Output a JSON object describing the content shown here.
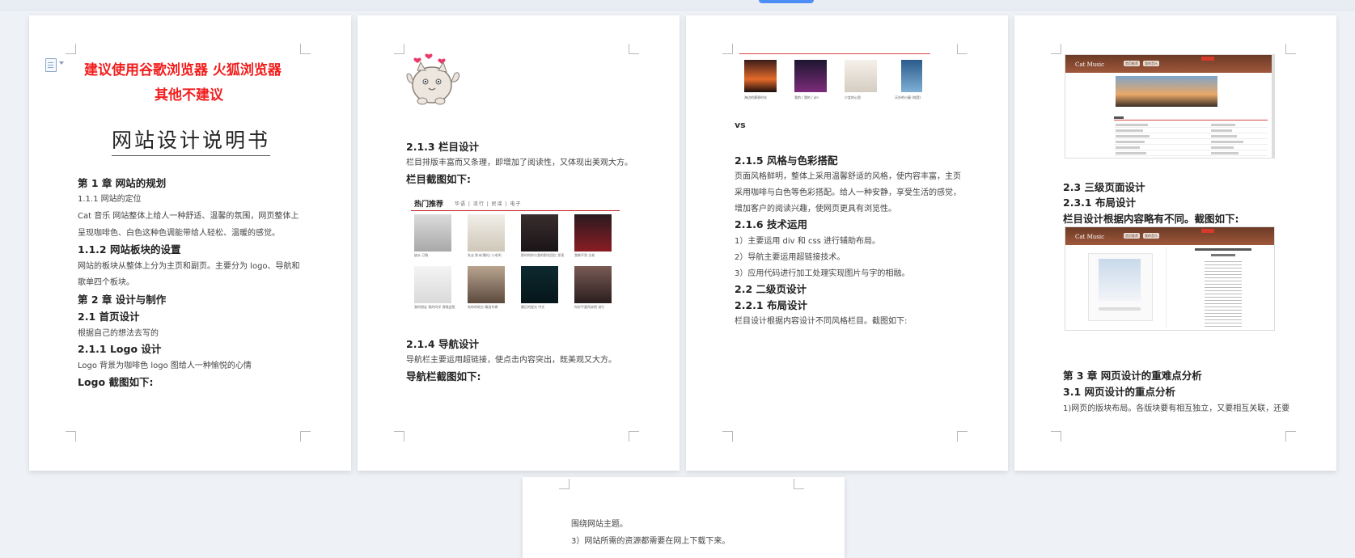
{
  "document_title": "网站设计说明书",
  "pages": {
    "p1": {
      "notice_line1": "建议使用谷歌浏览器   火狐浏览器",
      "notice_line2": "其他不建议",
      "title": "网站设计说明书",
      "ch1": "第 1 章  网站的规划",
      "s111": "1.1.1  网站的定位",
      "p111a": "Cat 音乐  网站整体上给人一种舒适、温馨的氛围，网页整体上",
      "p111b": "呈现咖啡色、白色这种色调能带给人轻松、温暖的感觉。",
      "s112": "1.1.2  网站板块的设置",
      "p112a": "网站的板块从整体上分为主页和副页。主要分为 logo、导航和",
      "p112b": "歌单四个板块。",
      "ch2": "第 2 章  设计与制作",
      "s21": "2.1  首页设计",
      "p21": "根据自己的想法去写的",
      "s211": "2.1.1 Logo 设计",
      "p211": "Logo 背景为咖啡色 logo 图给人一种愉悦的心情",
      "logo_caption": "Logo 截图如下:"
    },
    "p2": {
      "s213": "2.1.3  栏目设计",
      "p213": "栏目排版丰富而又条理，即增加了阅读性，又体现出美观大方。",
      "col_caption": "栏目截图如下:",
      "hot_title": "热门推荐",
      "hot_tabs": "华语 | 流行 | 民谣 | 电子",
      "thumb_captions": [
        "缺水\n已购",
        "失去\n陈未(赠礼) 小毛叫",
        "那时的你与我的那些回忆\n发现",
        "我做不到\n古老",
        "我的朋友 我的同学\n演唱会版",
        "有你的地方\n精选专辑",
        "最后的星光\n中文",
        "你好不要再说吧\n流行"
      ],
      "s214": "2.1.4  导航设计",
      "p214": "导航栏主要运用超链接，使点击内容突出，既美观又大方。",
      "nav_caption": "导航栏截图如下:"
    },
    "p3": {
      "strip_captions": [
        "海边的黄昏时光",
        "我的 / 我的 / jon",
        "少女的心思",
        "天外的小屋 (纯音)"
      ],
      "vs": "vs",
      "s215": "2.1.5  风格与色彩搭配",
      "p215a": "页面风格鲜明，整体上采用温馨舒适的风格，使内容丰富，主页",
      "p215b": "采用咖啡与白色等色彩搭配。给人一种安静，享受生活的感觉，",
      "p215c": "增加客户的阅读兴趣，使网页更具有浏览性。",
      "s216": "2.1.6  技术运用",
      "p216a": "1）主要运用 div 和 css 进行辅助布局。",
      "p216b": "2）导航主要运用超链接技术。",
      "p216c": "3）应用代码进行加工处理实现图片与字的相融。",
      "s22": "2.2  二级页设计",
      "s221": "2.2.1  布局设计",
      "p221": "栏目设计根据内容设计不同风格栏目。截图如下:"
    },
    "p4": {
      "web_logo": "Cat Music",
      "nav_items": [
        "首页推荐",
        "我的音乐"
      ],
      "s23": "2.3  三级页面设计",
      "s231": "2.3.1  布局设计",
      "p231": "栏目设计根据内容略有不同。截图如下:",
      "ch3": "第 3 章  网页设计的重难点分析",
      "s31": "3.1  网页设计的重点分析",
      "p31": "1)网页的版块布局。各版块要有相互独立，又要相互关联，还要"
    },
    "p5": {
      "line1": "围绕网站主题。",
      "line2": "3）网站所需的资源都需要在网上下载下来。"
    }
  },
  "colors": {
    "notice": "#f21d1d",
    "page_bg": "#ffffff",
    "canvas_bg": "#eef1f6",
    "accent_blue": "#4c8df6",
    "coffee": "#6b3a26"
  }
}
